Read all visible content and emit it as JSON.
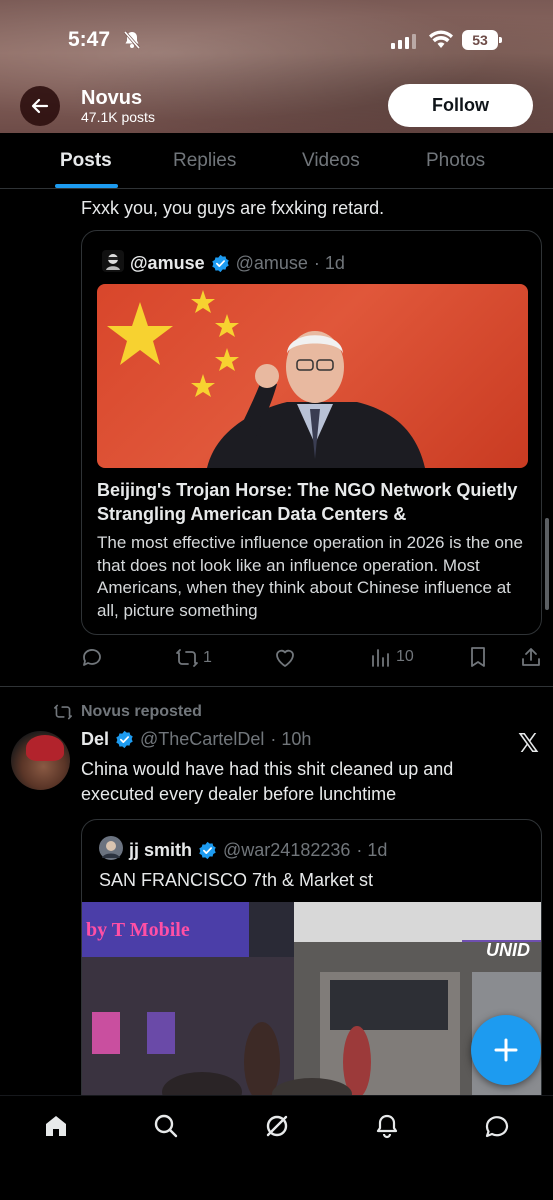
{
  "status_bar": {
    "time": "5:47",
    "battery": "53"
  },
  "profile": {
    "name": "Novus",
    "posts_count": "47.1K posts",
    "follow_label": "Follow"
  },
  "tabs": [
    {
      "label": "Posts",
      "active": true
    },
    {
      "label": "Replies",
      "active": false
    },
    {
      "label": "Videos",
      "active": false
    },
    {
      "label": "Photos",
      "active": false
    }
  ],
  "post1": {
    "text": "Fxxk you, you guys are fxxking retard.",
    "quote": {
      "name": "@amuse",
      "handle": "@amuse",
      "time": "· 1d",
      "article_title": "Beijing's Trojan Horse: The NGO Network Quietly Strangling American Data Centers &",
      "article_body": "The most effective influence operation in 2026 is the one that does not look like an influence operation. Most Americans, when they think about Chinese influence at all, picture something"
    },
    "actions": {
      "reposts": "1",
      "views": "10"
    }
  },
  "post2": {
    "repost_label": "Novus reposted",
    "author": "Del",
    "handle": "@TheCartelDel",
    "time": "· 10h",
    "text": "China would have had this shit cleaned up and executed every dealer before lunchtime",
    "quote": {
      "name": "jj smith",
      "handle": "@war24182236",
      "time": "· 1d",
      "text": "SAN FRANCISCO 7th & Market st",
      "signs": {
        "tmobile": "by T Mobile",
        "union": "UNID"
      }
    }
  },
  "colors": {
    "accent": "#1d9bf0",
    "background": "#000000",
    "muted": "#71767b"
  }
}
